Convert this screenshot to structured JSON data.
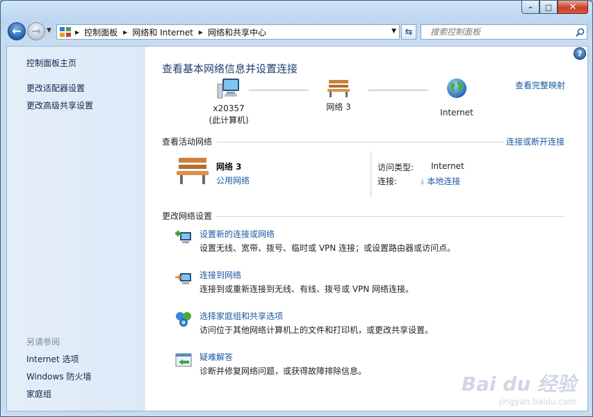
{
  "window": {
    "minimize_label": "–",
    "maximize_label": "□",
    "close_label": "✕"
  },
  "address": {
    "crumbs": [
      "控制面板",
      "网络和 Internet",
      "网络和共享中心"
    ]
  },
  "search": {
    "placeholder": "搜索控制面板"
  },
  "sidebar": {
    "items": [
      "控制面板主页",
      "更改适配器设置",
      "更改高级共享设置"
    ],
    "see_also_label": "另请参阅",
    "see_also": [
      "Internet 选项",
      "Windows 防火墙",
      "家庭组"
    ]
  },
  "main": {
    "title": "查看基本网络信息并设置连接",
    "full_map_link": "查看完整映射",
    "nodes": {
      "computer_name": "x20357",
      "computer_note": "(此计算机)",
      "network_name": "网络  3",
      "internet": "Internet"
    },
    "active": {
      "heading": "查看活动网络",
      "connect_link": "连接或断开连接",
      "network_name": "网络  3",
      "network_type": "公用网络",
      "access_type_label": "访问类型:",
      "access_type_value": "Internet",
      "connection_label": "连接:",
      "connection_value": "本地连接"
    },
    "settings": {
      "heading": "更改网络设置",
      "tasks": [
        {
          "title": "设置新的连接或网络",
          "desc": "设置无线、宽带、拨号、临时或 VPN 连接；或设置路由器或访问点。",
          "icon": "new-connection-icon"
        },
        {
          "title": "连接到网络",
          "desc": "连接到或重新连接到无线、有线、拨号或 VPN 网络连接。",
          "icon": "connect-network-icon"
        },
        {
          "title": "选择家庭组和共享选项",
          "desc": "访问位于其他网络计算机上的文件和打印机，或更改共享设置。",
          "icon": "homegroup-icon"
        },
        {
          "title": "疑难解答",
          "desc": "诊断并修复网络问题，或获得故障排除信息。",
          "icon": "troubleshoot-icon"
        }
      ]
    }
  },
  "watermark": {
    "brand": "Bai du 经验",
    "url": "jingyan.baidu.com"
  },
  "colors": {
    "link": "#1a5aa0",
    "title": "#1e3f70",
    "sidebar_bg": "#dde9f7"
  }
}
